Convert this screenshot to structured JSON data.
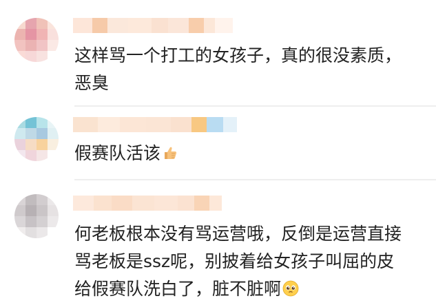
{
  "comments": [
    {
      "text_lines": [
        "这样骂一个打工的女孩子，真的很没素质，",
        "恶臭"
      ],
      "username_obscured": true,
      "avatar_colors": [
        "#f7d9cf",
        "#e6a5ae",
        "#f0c2b8",
        "#fae4dc",
        "#ecb4b0",
        "#e595a4",
        "#f0b4b4",
        "#f9e0dd",
        "#f2c3c0",
        "#ebb3b3",
        "#f1c4c5",
        "#fbe9e5",
        "#fadbd7",
        "#f7d8d8",
        "#f8e2e0",
        "#ffffff"
      ],
      "username_colors": [
        "#fde6d9",
        "#f6caa9",
        "#fbe8db",
        "#fde9db",
        "#fae1d1",
        "#fbe6d9",
        "#f8cdab",
        "#fce7d8",
        "#fff3ec"
      ]
    },
    {
      "text_lines": [
        "假赛队活该"
      ],
      "emoji": "thumbs-up-icon",
      "username_obscured": true,
      "avatar_colors": [
        "#a9dbe2",
        "#74c3d6",
        "#b8e4ea",
        "#e8f4f6",
        "#cfe9ef",
        "#bfd9e6",
        "#a8c9e0",
        "#e0f0f3",
        "#ead2dc",
        "#f6dcc4",
        "#f8d29d",
        "#f9efe0",
        "#f3e7ee",
        "#f0d5dc",
        "#f5e6e6",
        "#ffffff"
      ],
      "username_colors": [
        "#fae3d0",
        "#fdebdd",
        "#fce6d6",
        "#fbe5d5",
        "#fae1cf",
        "#f8c882",
        "#b9dcf2",
        "#e4f1f9"
      ]
    },
    {
      "text_lines": [
        "何老板根本没有骂运营哦，反倒是运营直接",
        "骂老板是ssz呢，别披着给女孩子叫屈的皮",
        "给假赛队洗白了，脏不脏啊"
      ],
      "emoji": "pleading-face-icon",
      "username_obscured": true,
      "avatar_colors": [
        "#d9d4d6",
        "#c1bcbe",
        "#d2cdcf",
        "#ebe8e9",
        "#cfcacc",
        "#b7b1b4",
        "#cac5c7",
        "#e6e2e3",
        "#dad6d8",
        "#c7c2c5",
        "#d4d0d2",
        "#ece9ea",
        "#efecec",
        "#e2dfe0",
        "#ebe8e9",
        "#ffffff"
      ],
      "username_colors": [
        "#fde9dc",
        "#fbe2cf",
        "#fadcc6",
        "#fbe4d3",
        "#fce6d7",
        "#fbe2d1",
        "#f9d4b6",
        "#fde8d9"
      ]
    }
  ]
}
